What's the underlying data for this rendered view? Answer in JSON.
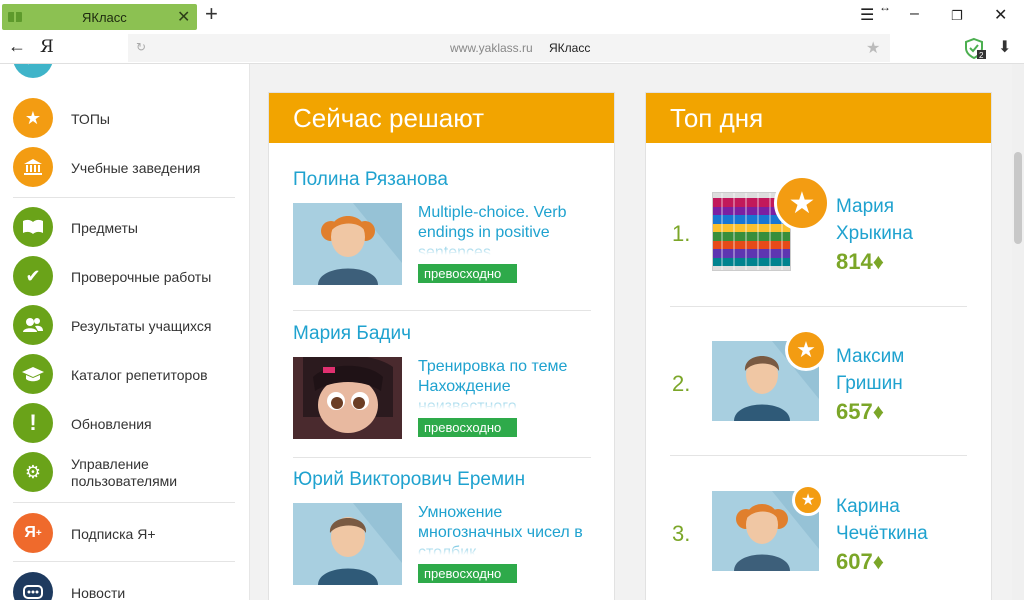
{
  "browser": {
    "tab_title": "ЯКласс",
    "url_host": "www.yaklass.ru",
    "url_title": "ЯКласс",
    "yandex_letter": "Я",
    "ext_badge": "2"
  },
  "sidebar": {
    "items": [
      {
        "label": "ТОПы",
        "icon": "star-icon",
        "color": "#f39c12"
      },
      {
        "label": "Учебные заведения",
        "icon": "institution-icon",
        "color": "#f39c12"
      },
      {
        "label": "Предметы",
        "icon": "book-icon",
        "color": "#6aa319"
      },
      {
        "label": "Проверочные работы",
        "icon": "check-icon",
        "color": "#6aa319"
      },
      {
        "label": "Результаты учащихся",
        "icon": "users-icon",
        "color": "#6aa319"
      },
      {
        "label": "Каталог репетиторов",
        "icon": "graduation-cap-icon",
        "color": "#6aa319"
      },
      {
        "label": "Обновления",
        "icon": "exclamation-icon",
        "color": "#6aa319"
      },
      {
        "label": "Управление пользователями",
        "label_line1": "Управление",
        "label_line2": "пользователями",
        "icon": "user-gear-icon",
        "color": "#6aa319"
      },
      {
        "label": "Подписка Я+",
        "icon": "yaplus-icon",
        "color": "#ef6a2c"
      },
      {
        "label": "Новости",
        "icon": "chat-icon",
        "color": "#1e3a5f"
      }
    ]
  },
  "now_solving": {
    "title": "Сейчас решают",
    "entries": [
      {
        "name": "Полина Рязанова",
        "task": "Multiple-choice. Verb endings in positive sentences",
        "badge": "превосходно"
      },
      {
        "name": "Мария Бадич",
        "task": "Тренировка по теме Нахождение неизвестного",
        "badge": "превосходно"
      },
      {
        "name": "Юрий Викторович Еремин",
        "task": "Умножение многозначных чисел в столбик",
        "badge": "превосходно"
      }
    ]
  },
  "top_day": {
    "title": "Топ дня",
    "entries": [
      {
        "rank": "1.",
        "first": "Мария",
        "last": "Хрыкина",
        "score": "814♦"
      },
      {
        "rank": "2.",
        "first": "Максим",
        "last": "Гришин",
        "score": "657♦"
      },
      {
        "rank": "3.",
        "first": "Карина",
        "last": "Чечёткина",
        "score": "607♦"
      }
    ]
  }
}
